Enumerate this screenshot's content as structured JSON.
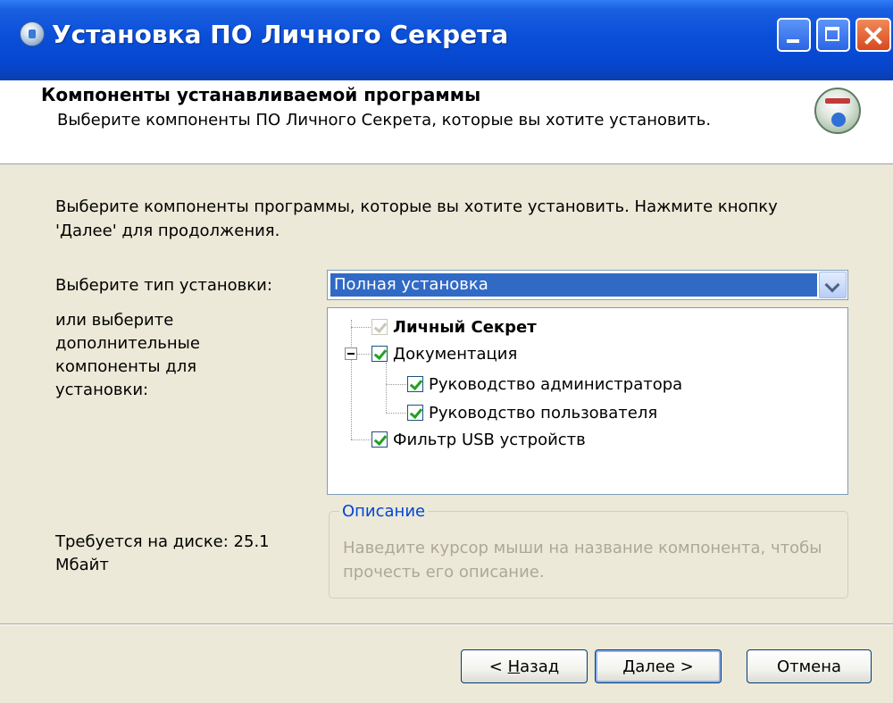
{
  "window": {
    "title": "Установка ПО Личного Секрета"
  },
  "header": {
    "title": "Компоненты устанавливаемой программы",
    "subtitle": "Выберите компоненты ПО Личного Секрета, которые вы хотите установить."
  },
  "body": {
    "intro": "Выберите компоненты программы, которые вы хотите установить. Нажмите кнопку 'Далее' для продолжения.",
    "install_type_label": "Выберите тип установки:",
    "install_type_value": "Полная установка",
    "components_label": "или выберите дополнительные компоненты для установки:",
    "disk_required": "Требуется на диске: 25.1 Мбайт",
    "components": [
      {
        "label": "Личный Секрет",
        "checked": true,
        "disabled": true,
        "bold": true
      },
      {
        "label": "Документация",
        "checked": true,
        "expanded": true
      },
      {
        "label": "Руководство администратора",
        "checked": true
      },
      {
        "label": "Руководство пользователя",
        "checked": true
      },
      {
        "label": "Фильтр USB устройств",
        "checked": true
      }
    ],
    "description_title": "Описание",
    "description_text": "Наведите курсор мыши на название компонента, чтобы прочесть его описание."
  },
  "buttons": {
    "back_prefix": "< ",
    "back_accel": "Н",
    "back_rest": "азад",
    "next_accel": "Д",
    "next_rest": "алее >",
    "cancel": "Отмена"
  },
  "colors": {
    "titlebar": "#0a4fd8",
    "dialog_bg": "#ece9d8",
    "selection": "#316ac5",
    "checkmark": "#21a121",
    "group_title": "#0046d5"
  }
}
